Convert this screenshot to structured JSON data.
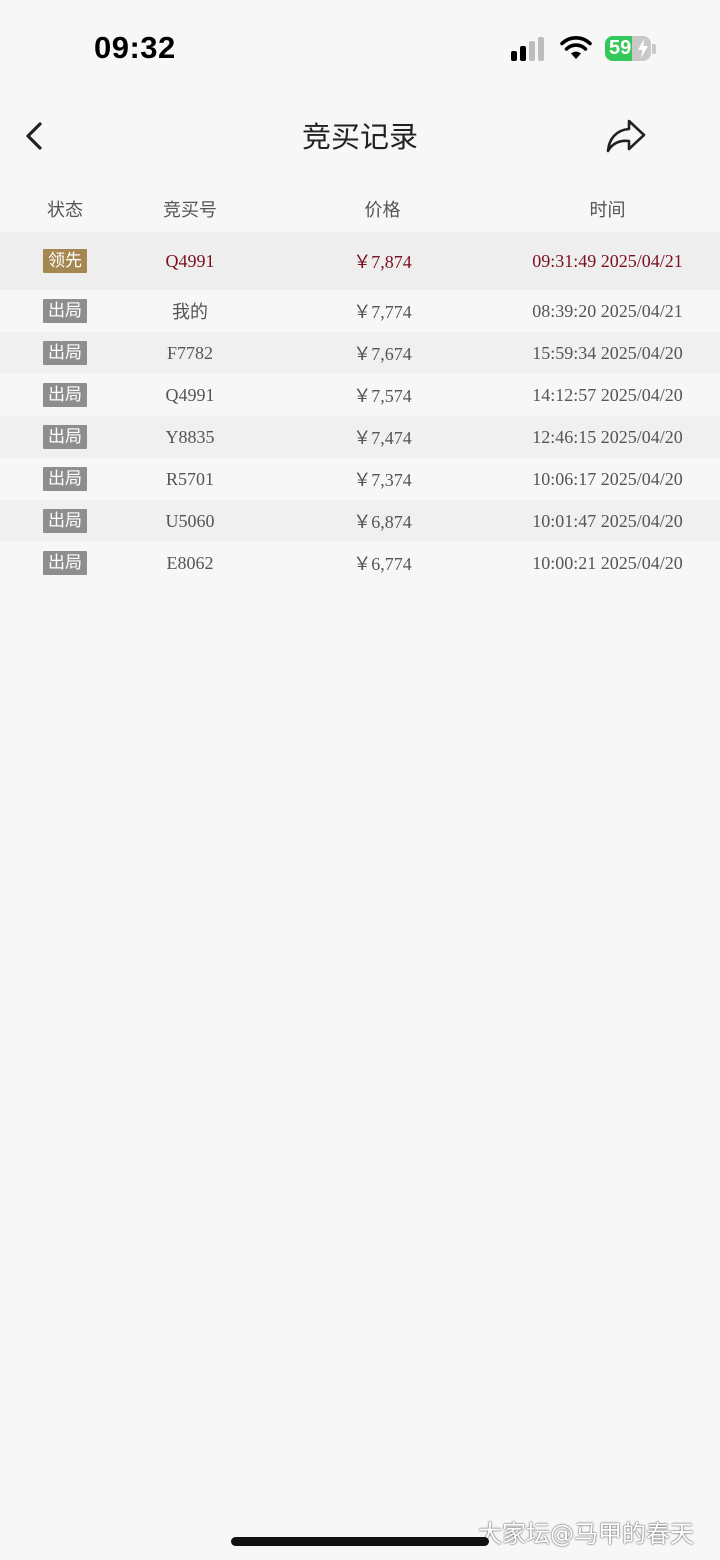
{
  "status_bar": {
    "time": "09:32",
    "battery": "59",
    "battery_level": 0.59
  },
  "nav": {
    "title": "竞买记录",
    "back_icon": "chevron-left-icon",
    "share_icon": "share-arrow-icon"
  },
  "table": {
    "headers": [
      "状态",
      "竞买号",
      "价格",
      "时间"
    ],
    "rows": [
      {
        "status": "领先",
        "status_color": "#a5884f",
        "bidder": "Q4991",
        "price": "￥7,874",
        "time": "09:31:49 2025/04/21"
      },
      {
        "status": "出局",
        "status_color": "#8e8e8e",
        "bidder": "我的",
        "price": "￥7,774",
        "time": "08:39:20 2025/04/21"
      },
      {
        "status": "出局",
        "status_color": "#8e8e8e",
        "bidder": "F7782",
        "price": "￥7,674",
        "time": "15:59:34 2025/04/20"
      },
      {
        "status": "出局",
        "status_color": "#8e8e8e",
        "bidder": "Q4991",
        "price": "￥7,574",
        "time": "14:12:57 2025/04/20"
      },
      {
        "status": "出局",
        "status_color": "#8e8e8e",
        "bidder": "Y8835",
        "price": "￥7,474",
        "time": "12:46:15 2025/04/20"
      },
      {
        "status": "出局",
        "status_color": "#8e8e8e",
        "bidder": "R5701",
        "price": "￥7,374",
        "time": "10:06:17 2025/04/20"
      },
      {
        "status": "出局",
        "status_color": "#8e8e8e",
        "bidder": "U5060",
        "price": "￥6,874",
        "time": "10:01:47 2025/04/20"
      },
      {
        "status": "出局",
        "status_color": "#8e8e8e",
        "bidder": "E8062",
        "price": "￥6,774",
        "time": "10:00:21 2025/04/20"
      }
    ]
  },
  "watermark": "大家坛@马甲的春天",
  "colors": {
    "leading_text": "#7a1020",
    "leading_badge": "#a5884f",
    "out_badge": "#8e8e8e",
    "battery_green": "#34c759"
  }
}
